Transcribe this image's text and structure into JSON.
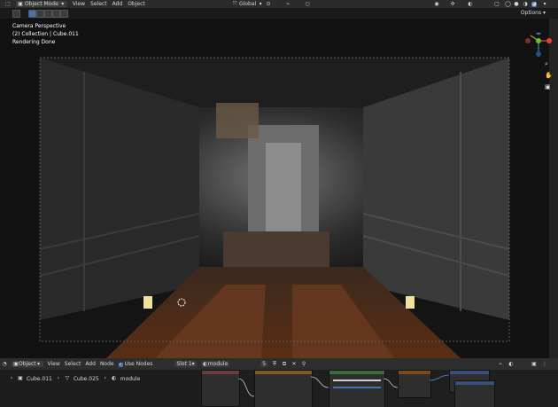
{
  "header": {
    "mode": "Object Mode",
    "menu": [
      "View",
      "Select",
      "Add",
      "Object"
    ],
    "transform_orientation": "Global",
    "options_label": "Options"
  },
  "viewport": {
    "overlay": {
      "line1": "Camera Perspective",
      "line2": "(2) Collection | Cube.011",
      "line3": "Rendering Done"
    }
  },
  "node_editor": {
    "editor_type": "Object",
    "menu": [
      "View",
      "Select",
      "Add",
      "Node"
    ],
    "use_nodes_label": "Use Nodes",
    "slot": "Slot 1",
    "material": "module",
    "users": "5"
  },
  "breadcrumb": {
    "object": "Cube.011",
    "mesh": "Cube.025",
    "material": "module"
  },
  "colors": {
    "accent": "#4772b3",
    "gizmo_x": "#e8413a",
    "gizmo_y": "#79b829",
    "gizmo_z": "#3b7fd8"
  }
}
